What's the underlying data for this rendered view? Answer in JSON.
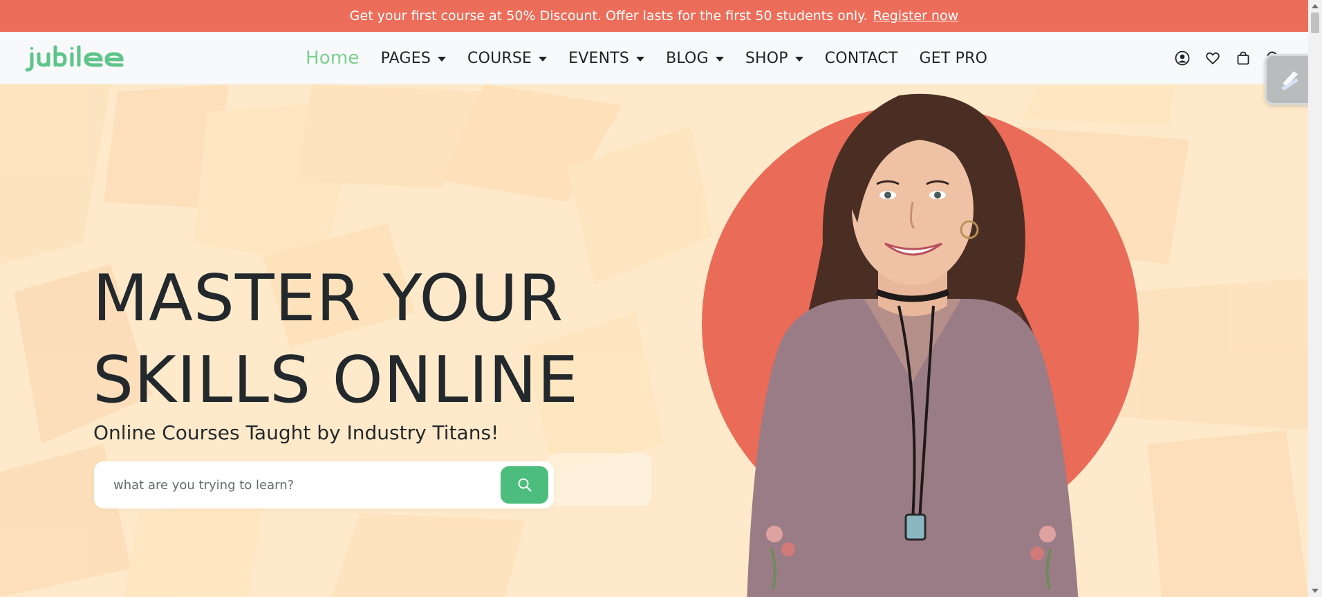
{
  "promo": {
    "text": "Get your first course at 50% Discount. Offer lasts for the first 50 students only.",
    "link": "Register now"
  },
  "header": {
    "logo_text": "jubilee",
    "nav": [
      {
        "label": "Home",
        "active": true,
        "dropdown": false
      },
      {
        "label": "PAGES",
        "dropdown": true
      },
      {
        "label": "COURSE",
        "dropdown": true
      },
      {
        "label": "EVENTS",
        "dropdown": true
      },
      {
        "label": "BLOG",
        "dropdown": true
      },
      {
        "label": "SHOP",
        "dropdown": true
      },
      {
        "label": "CONTACT",
        "dropdown": false
      },
      {
        "label": "GET PRO",
        "dropdown": false
      }
    ],
    "icons": [
      "user-icon",
      "heart-icon",
      "bag-icon",
      "search-icon"
    ]
  },
  "hero": {
    "title_line1": "MASTER YOUR",
    "title_line2": "SKILLS ONLINE",
    "subtitle": "Online Courses Taught by Industry Titans!",
    "search_placeholder": "what are you trying to learn?"
  },
  "colors": {
    "promo": "#ec6d59",
    "accent_green": "#4cbd7d",
    "nav_active": "#7ccf8f",
    "hero_bg": "#feeaca",
    "circle": "#ea6b57"
  }
}
